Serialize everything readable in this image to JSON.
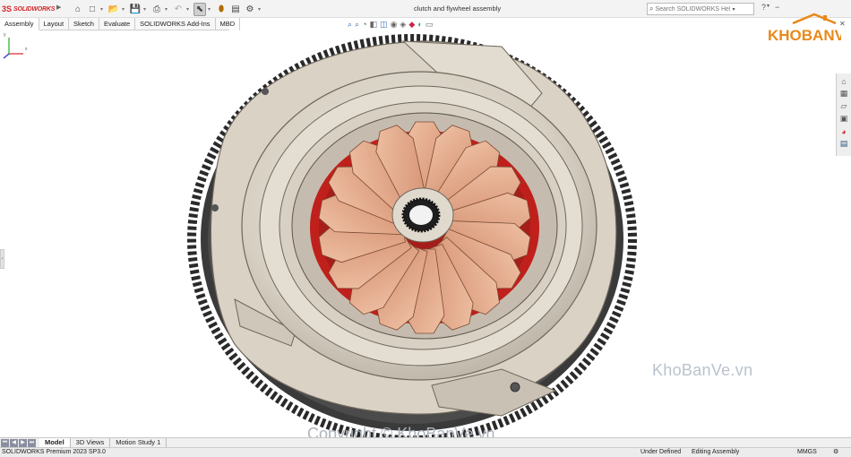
{
  "app": {
    "logo_ds": "3S",
    "logo_brand": "SOLIDWORKS",
    "document_title": "clutch and flywheel assembly",
    "search_placeholder": "Search SOLIDWORKS Help"
  },
  "command_tabs": [
    "Assembly",
    "Layout",
    "Sketch",
    "Evaluate",
    "SOLIDWORKS Add-Ins",
    "MBD"
  ],
  "bottom_tabs": [
    "Model",
    "3D Views",
    "Motion Study 1"
  ],
  "status": {
    "product": "SOLIDWORKS Premium 2023 SP3.0",
    "definition": "Under Defined",
    "mode": "Editing Assembly",
    "units": "MMGS"
  },
  "watermarks": {
    "logo": "KHOBANVE",
    "site": "KhoBanVe.vn",
    "copyright": "Copyright © KhoBanVe.vn"
  },
  "triad": {
    "x": "x",
    "y": "y"
  },
  "colors": {
    "flywheel": "#2b2b2b",
    "pressure_plate": "#d9d2c5",
    "diaphragm_spring": "#e3a585",
    "disc_red": "#c0201c",
    "brand_red": "#d3272a",
    "watermark_orange": "#e8891a"
  }
}
